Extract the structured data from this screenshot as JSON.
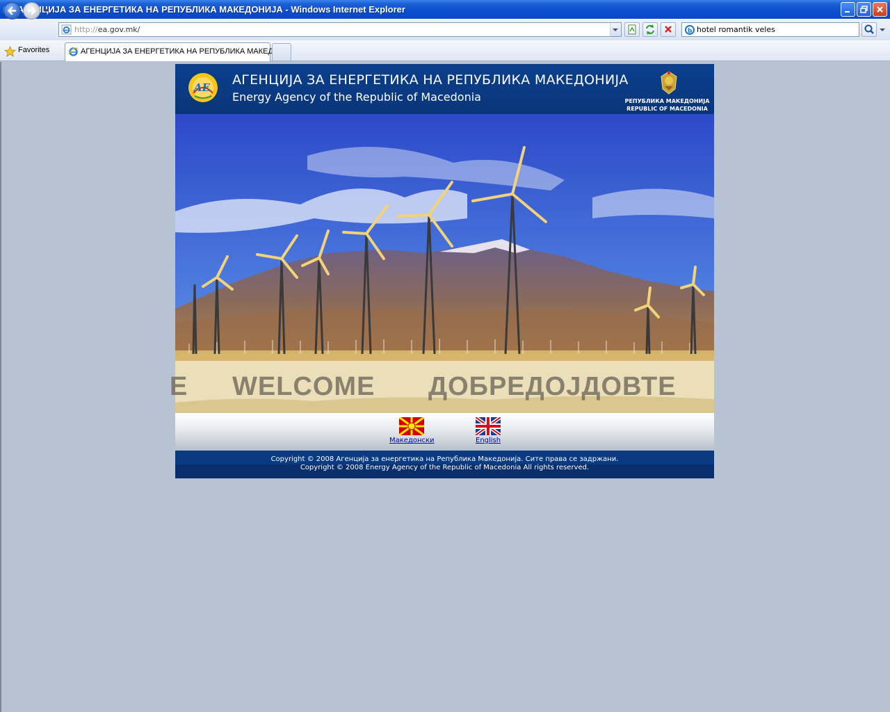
{
  "window": {
    "title": "АГЕНЦИЈА ЗА ЕНЕРГЕТИКА НА РЕПУБЛИКА МАКЕДОНИЈА - Windows Internet Explorer"
  },
  "toolbar": {
    "url_protocol": "http://",
    "url_host": "ea.gov.mk/",
    "search_query": "hotel romantik veles"
  },
  "favorites": {
    "label": "Favorites"
  },
  "tabs": [
    {
      "label": "АГЕНЦИЈА ЗА ЕНЕРГЕТИКА НА РЕПУБЛИКА МАКЕД..."
    }
  ],
  "site": {
    "title_mk": "АГЕНЦИЈА ЗА ЕНЕРГЕТИКА НА РЕПУБЛИКА МАКЕДОНИЈА",
    "title_en": "Energy Agency of the Republic of Macedonia",
    "coat_mk": "РЕПУБЛИКА МАКЕДОНИЈА",
    "coat_en": "REPUBLIC OF MACEDONIA",
    "welcome_edge": "E",
    "welcome_en": "WELCOME",
    "welcome_mk": "ДОБРЕДОЈДОВТЕ",
    "lang_mk": "Македонски",
    "lang_en": "English",
    "copyright_mk": "Copyright © 2008 Агенција за енергетика на Република Македонија. Сите права се задржани.",
    "copyright_en": "Copyright © 2008 Energy Agency of the Republic of Macedonia All rights reserved."
  },
  "colors": {
    "header_blue": "#0a3a82",
    "page_background": "#b7c2d3",
    "link": "#0000cc"
  }
}
